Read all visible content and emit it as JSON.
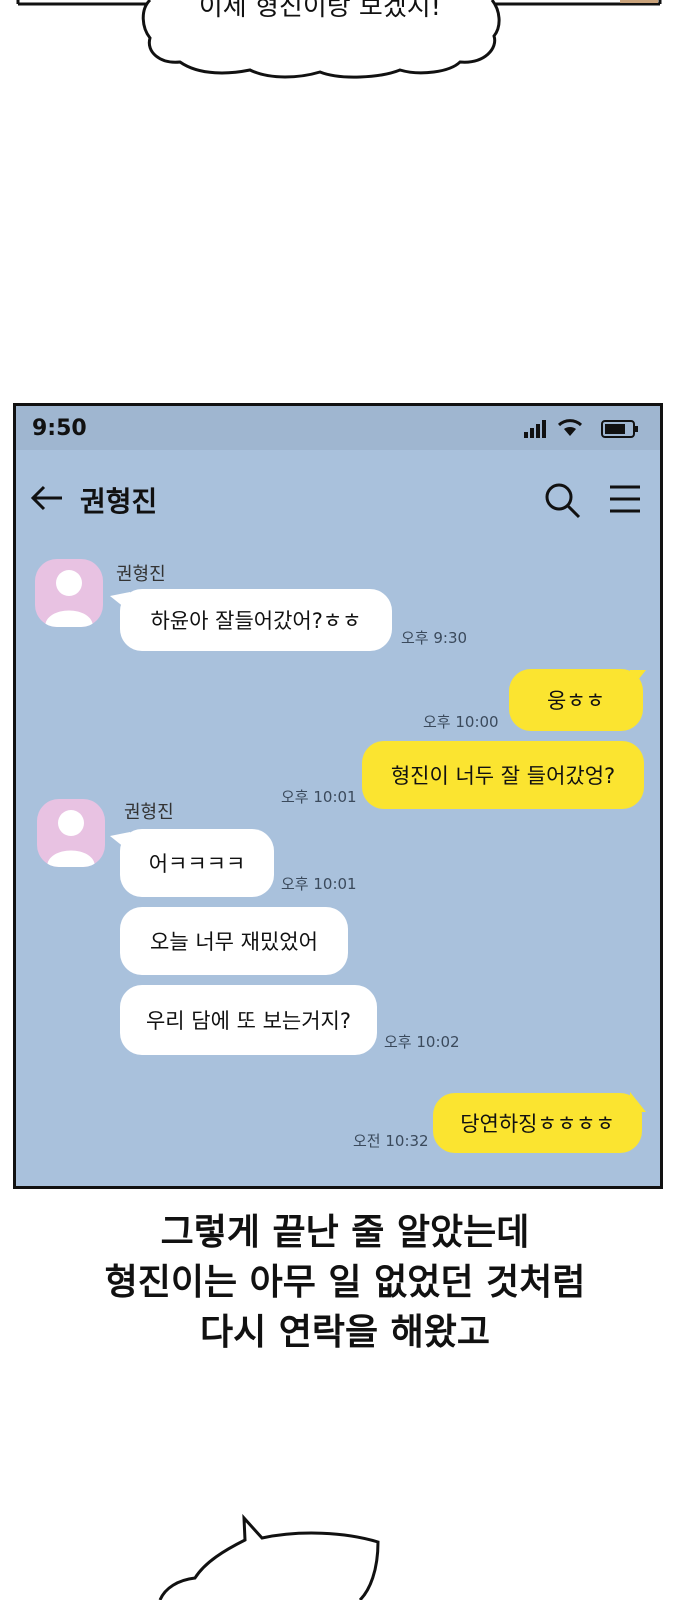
{
  "top_bubble": {
    "text": "이제 형진이랑 보겠지!"
  },
  "phone": {
    "status": {
      "time": "9:50"
    },
    "header": {
      "title": "권형진"
    },
    "messages": [
      {
        "sender": "권형진",
        "text": "하윤아 잘들어갔어?ㅎㅎ",
        "time": "오후 9:30"
      },
      {
        "text": "웅ㅎㅎ",
        "time": "오후 10:00"
      },
      {
        "text": "형진이 너두 잘 들어갔엉?",
        "time": "오후 10:01"
      },
      {
        "sender": "권형진",
        "text": "어ㅋㅋㅋㅋ",
        "time": "오후 10:01"
      },
      {
        "text": "오늘 너무 재밌었어"
      },
      {
        "text": "우리 담에 또 보는거지?",
        "time": "오후 10:02"
      },
      {
        "text": "당연하징ㅎㅎㅎㅎ",
        "time": "오전 10:32"
      }
    ]
  },
  "caption": {
    "line1": "그렇게 끝난 줄 알았는데",
    "line2": "형진이는 아무 일 없었던 것처럼",
    "line3": "다시 연락을 해왔고"
  },
  "colors": {
    "chat_bg": "#a9c1dc",
    "my_bubble": "#fbe430",
    "their_bubble": "#ffffff",
    "avatar": "#e8c2e2"
  }
}
